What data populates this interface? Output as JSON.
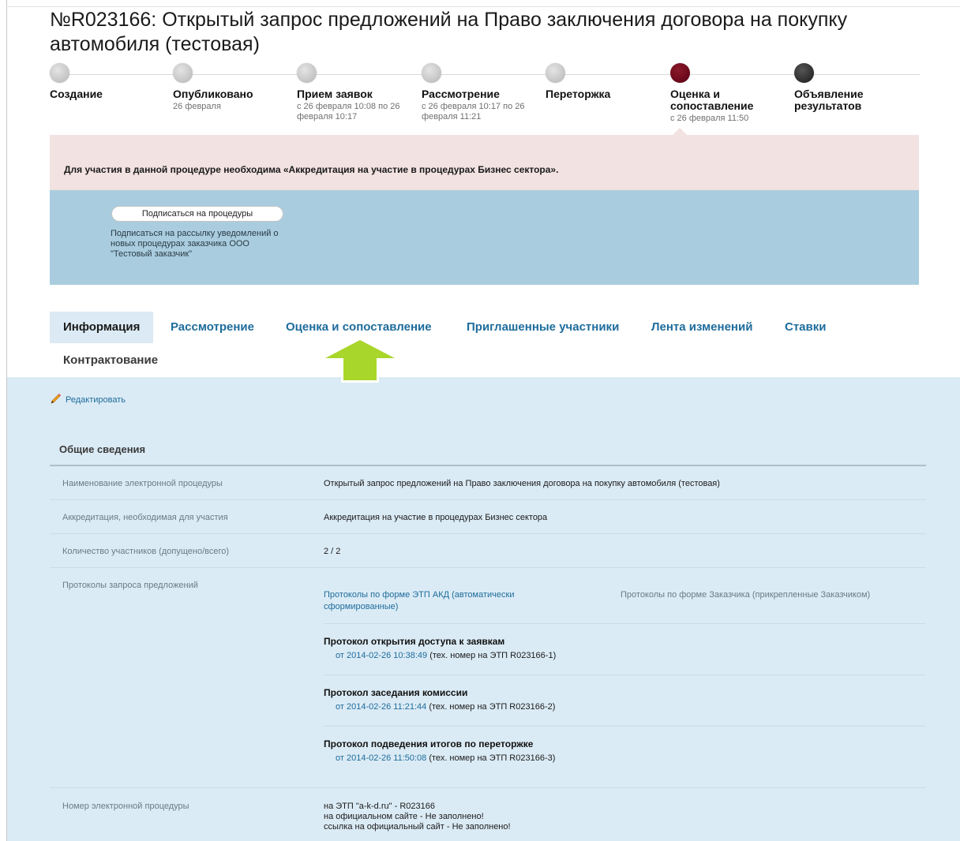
{
  "page": {
    "title": "№R023166: Открытый запрос предложений на Право заключения договора на покупку автомобиля (тестовая)"
  },
  "stages": [
    {
      "name": "Создание",
      "date": "",
      "state": "done"
    },
    {
      "name": "Опубликовано",
      "date": "26 февраля",
      "state": "done"
    },
    {
      "name": "Прием заявок",
      "date": "с 26 февраля 10:08 по 26 февраля 10:17",
      "state": "done"
    },
    {
      "name": "Рассмотрение",
      "date": "с 26 февраля 10:17 по 26 февраля 11:21",
      "state": "done"
    },
    {
      "name": "Переторжка",
      "date": "",
      "state": "done"
    },
    {
      "name": "Оценка и сопоставление",
      "date": "с 26 февраля 11:50",
      "state": "current"
    },
    {
      "name": "Объявление результатов",
      "date": "",
      "state": "upcoming"
    }
  ],
  "notice": "Для участия в данной процедуре необходима «Аккредитация на участие в процедурах Бизнес сектора».",
  "subscribe": {
    "button_label": "Подписаться на процедуры",
    "note": "Подписаться на рассылку уведомлений о новых процедурах заказчика ООО \"Тестовый заказчик\""
  },
  "tabs": {
    "info": "Информация",
    "review": "Рассмотрение",
    "evaluation": "Оценка и сопоставление",
    "invited": "Приглашенные участники",
    "changes": "Лента изменений",
    "bids": "Ставки",
    "contracting": "Контрактование",
    "active": "info"
  },
  "edit_label": "Редактировать",
  "section_title": "Общие сведения",
  "rows": {
    "name": {
      "label": "Наименование электронной процедуры",
      "value": "Открытый запрос предложений на Право заключения договора на покупку автомобиля (тестовая)"
    },
    "accreditation": {
      "label": "Аккредитация, необходимая для участия",
      "value": "Аккредитация на участие в процедурах Бизнес сектора"
    },
    "participants": {
      "label": "Количество участников (допущено/всего)",
      "value": "2 / 2"
    },
    "protocols": {
      "label": "Протоколы запроса предложений",
      "etp_link": "Протоколы по форме ЭТП АКД (автоматически сформированные)",
      "customer_link": "Протоколы по форме Заказчика (прикрепленные Заказчиком)",
      "items": [
        {
          "title": "Протокол открытия доступа к заявкам",
          "date_link": "от 2014-02-26 10:38:49",
          "tech": "(тех. номер на ЭТП R023166-1)"
        },
        {
          "title": "Протокол заседания комиссии",
          "date_link": "от 2014-02-26 11:21:44",
          "tech": "(тех. номер на ЭТП R023166-2)"
        },
        {
          "title": "Протокол подведения итогов по переторжке",
          "date_link": "от 2014-02-26 11:50:08",
          "tech": "(тех. номер на ЭТП R023166-3)"
        }
      ]
    },
    "number": {
      "label": "Номер электронной процедуры",
      "lines": [
        "на ЭТП \"a-k-d.ru\" - R023166",
        "на официальном сайте - Не заполнено!",
        "ссылка на официальный сайт - Не заполнено!"
      ]
    }
  },
  "colors": {
    "accent": "#1e6c9c",
    "current_stage": "#6a0a1e",
    "arrow": "#a8d62a",
    "notice_bg": "#f2e2e2",
    "subscribe_bg": "#a9cddf",
    "content_bg": "#dbebf5"
  }
}
